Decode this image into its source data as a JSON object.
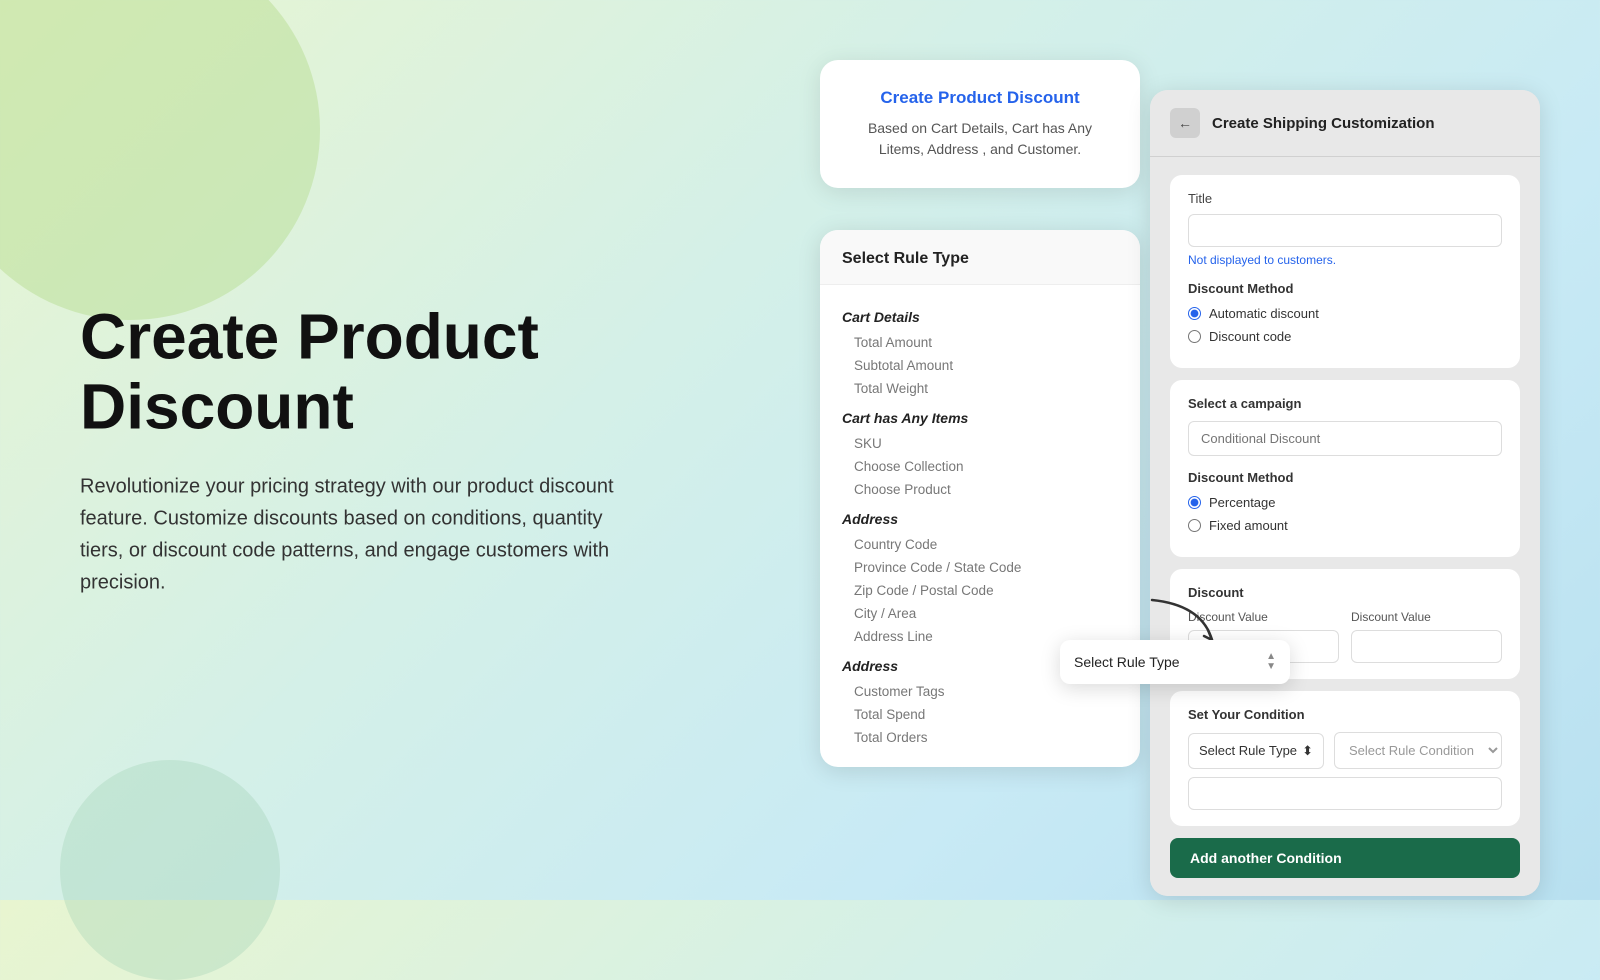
{
  "background": {
    "gradient": "linear-gradient(135deg, #e8f5d0 0%, #d4f0e8 40%, #c8eaf5 70%, #b8e0f0 100%)"
  },
  "left": {
    "heading": "Create Product Discount",
    "description": "Revolutionize your pricing strategy with our product discount feature. Customize discounts based on conditions, quantity tiers, or discount code patterns, and engage customers with precision."
  },
  "card_product": {
    "title": "Create Product Discount",
    "description": "Based on Cart Details, Cart has Any Litems, Address , and Customer."
  },
  "card_rule": {
    "header": "Select Rule Type",
    "sections": [
      {
        "title": "Cart Details",
        "items": [
          "Total Amount",
          "Subtotal Amount",
          "Total Weight"
        ]
      },
      {
        "title": "Cart has Any Items",
        "items": [
          "SKU",
          "Choose Collection",
          "Choose Product"
        ]
      },
      {
        "title": "Address",
        "items": [
          "Country Code",
          "Province Code / State Code",
          "Zip Code / Postal Code",
          "City / Area",
          "Address Line"
        ]
      },
      {
        "title": "Address",
        "items": [
          "Customer Tags",
          "Total Spend",
          "Total Orders"
        ]
      }
    ]
  },
  "card_shipping": {
    "header_title": "Create Shipping Customization",
    "back_icon": "←",
    "title_label": "Title",
    "title_placeholder": "",
    "title_helper": "Not displayed to customers.",
    "discount_method_label": "Discount Method",
    "discount_method_options": [
      "Automatic discount",
      "Discount code"
    ],
    "discount_method_selected": "Automatic discount",
    "campaign_label": "Select a campaign",
    "campaign_placeholder": "Conditional Discount",
    "discount_method2_label": "Discount Method",
    "discount_method2_options": [
      "Percentage",
      "Fixed amount"
    ],
    "discount_method2_selected": "Percentage",
    "discount_label": "Discount",
    "discount_value1_label": "Discount Value",
    "discount_value2_label": "Discount Value",
    "condition_label": "Set Your Condition",
    "rule_type_placeholder": "Select Rule Type",
    "rule_condition_placeholder": "Select Rule Condition",
    "add_condition_label": "Add another Condition"
  },
  "floating_dropdown": {
    "label": "Select Rule Type",
    "arrow_up": "▲",
    "arrow_down": "▼"
  }
}
